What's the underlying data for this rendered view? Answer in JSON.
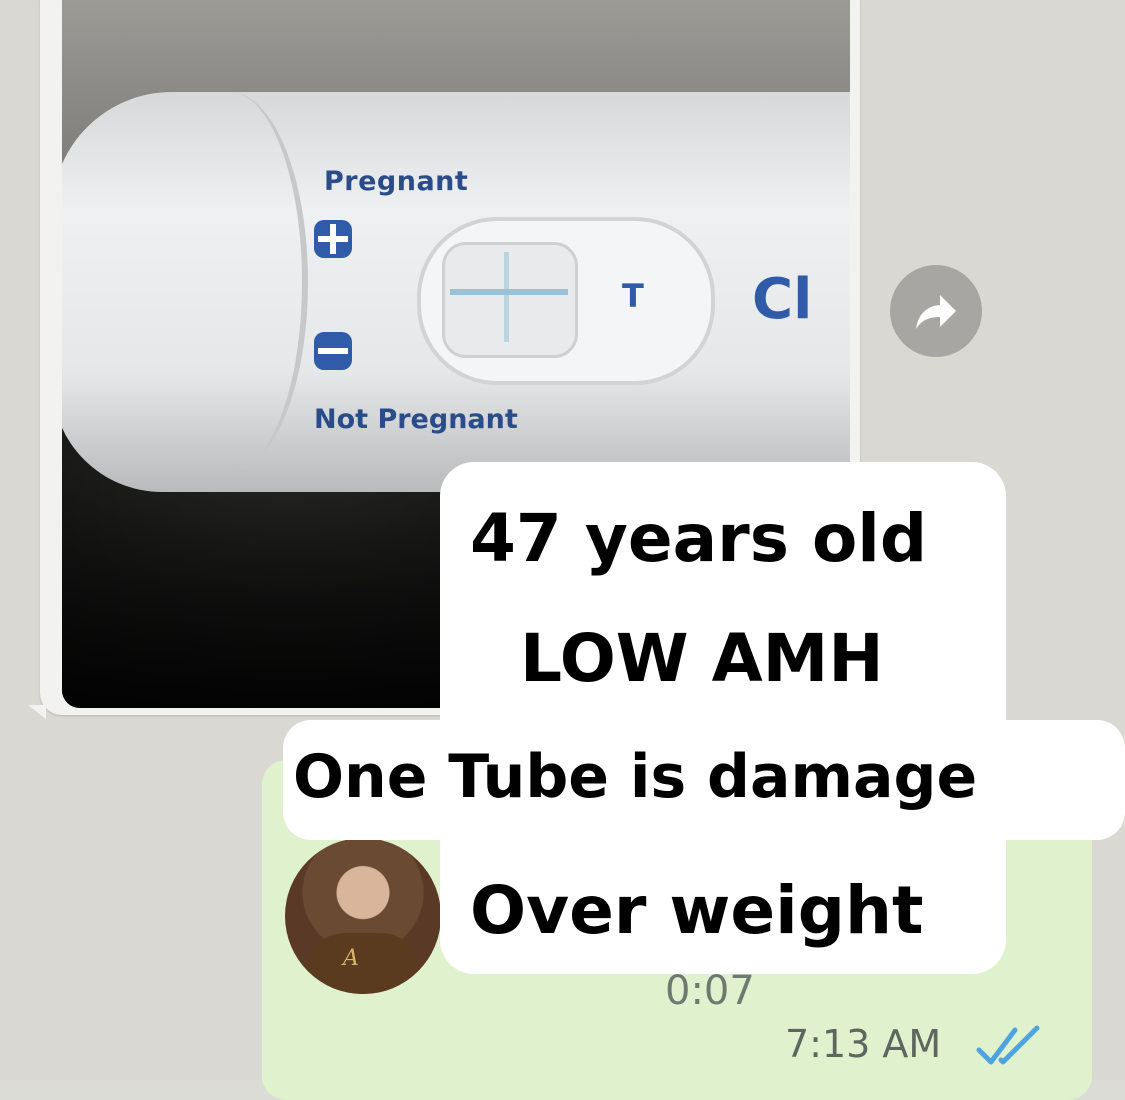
{
  "photo": {
    "labels": {
      "pregnant": "Pregnant",
      "not_pregnant": "Not Pregnant",
      "t_mark": "T",
      "brand_partial": "Cl"
    },
    "icons": [
      "plus-icon",
      "minus-icon"
    ]
  },
  "forward": {
    "icon": "forward-arrow-icon"
  },
  "voice_message": {
    "duration": "0:07",
    "time": "7:13 AM",
    "status_icon": "double-check-icon",
    "status_color": "#4fa3e0"
  },
  "overlay_text": {
    "line1": "47 years old",
    "line2": "LOW AMH",
    "line3": "One Tube is damage",
    "line4": "Over weight"
  },
  "colors": {
    "incoming_bubble": "#f2f2f0",
    "outgoing_bubble": "#dff1cd",
    "test_blue": "#2f5ba8"
  }
}
